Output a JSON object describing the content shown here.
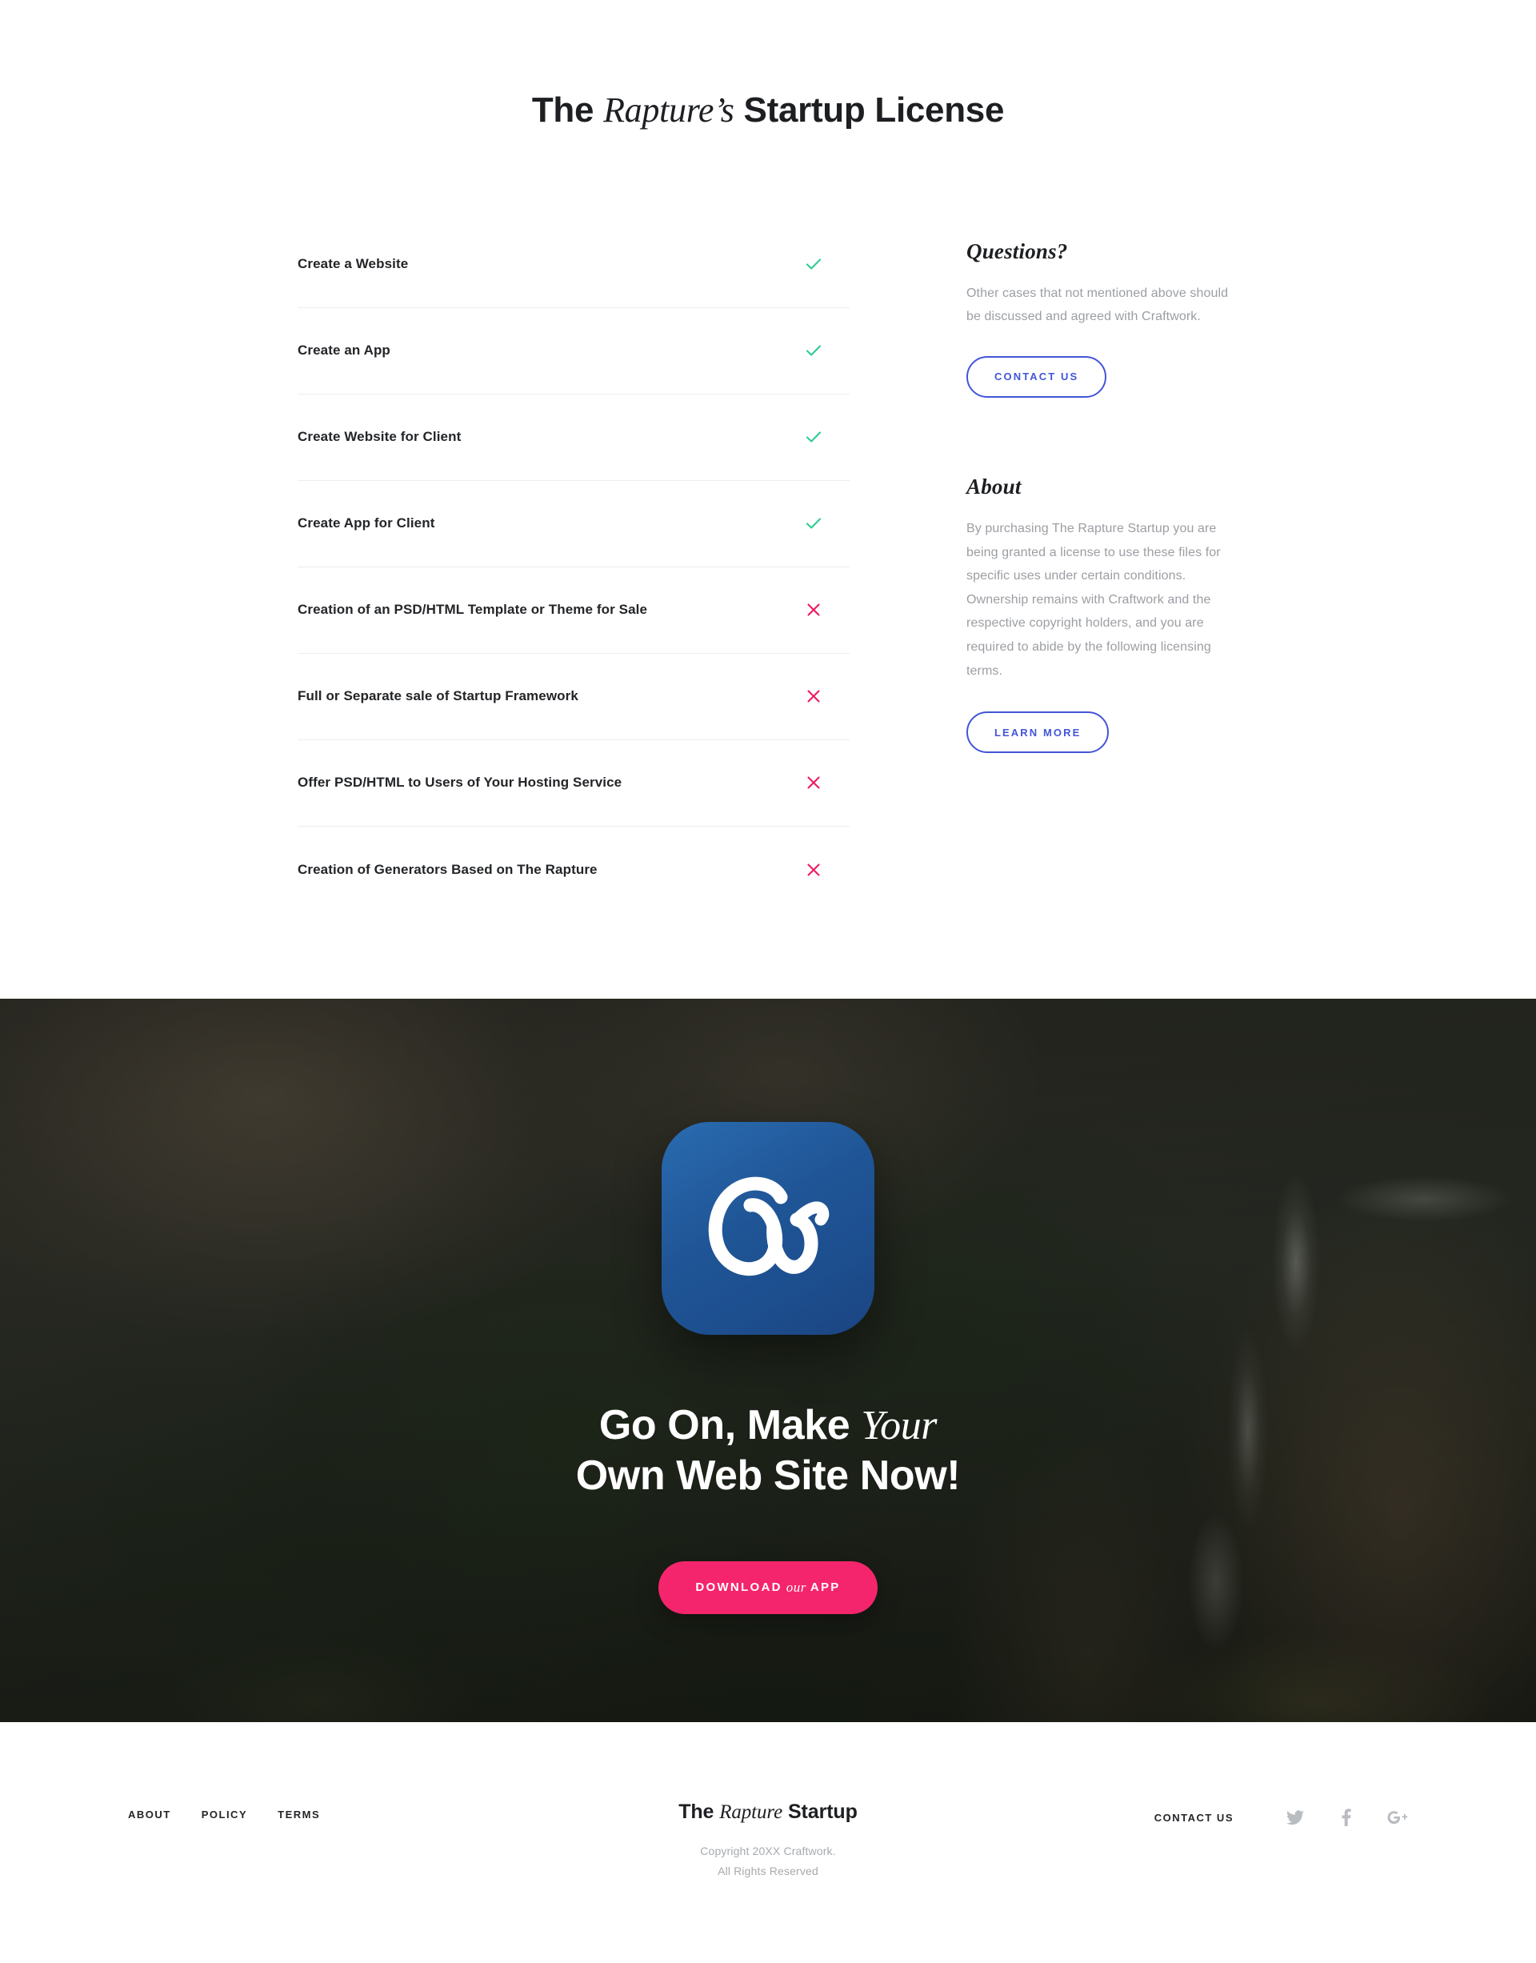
{
  "license": {
    "title_prefix": "The ",
    "title_italic": "Rapture’s",
    "title_suffix": " Startup License",
    "permissions": [
      {
        "label": "Create a Website",
        "mark": "check"
      },
      {
        "label": "Create an App",
        "mark": "check"
      },
      {
        "label": "Create Website for Client",
        "mark": "check"
      },
      {
        "label": "Create App for Client",
        "mark": "check"
      },
      {
        "label": "Creation of an PSD/HTML Template or Theme for Sale",
        "mark": "cross"
      },
      {
        "label": "Full or Separate sale of Startup Framework",
        "mark": "cross"
      },
      {
        "label": "Offer PSD/HTML to Users of Your Hosting Service",
        "mark": "cross"
      },
      {
        "label": "Creation of Generators Based on The Rapture",
        "mark": "cross"
      }
    ],
    "aside": {
      "questions_heading": "Questions?",
      "questions_body": "Other cases that not mentioned above should be discussed and agreed with Craftwork.",
      "contact_button": "Contact Us",
      "about_heading": "About",
      "about_body": "By purchasing The Rapture Startup you are being granted a license to use these files for specific uses under certain conditions. Ownership remains with Craftwork and the respective copyright holders, and you are required to abide by the following licensing terms.",
      "learn_button": "Learn More"
    }
  },
  "hero": {
    "app_icon_name": "craftwork-cw-monogram-icon",
    "title_line1_prefix": "Go On, Make ",
    "title_line1_italic": "Your",
    "title_line2": "Own Web Site Now!",
    "download_prefix": "Download",
    "download_italic": "our",
    "download_suffix": "App"
  },
  "footer": {
    "nav": [
      {
        "label": "About"
      },
      {
        "label": "Policy"
      },
      {
        "label": "Terms"
      }
    ],
    "brand_prefix": "The ",
    "brand_italic": "Rapture",
    "brand_suffix": " Startup",
    "copyright_line1": "Copyright 20XX Craftwork.",
    "copyright_line2": "All Rights Reserved",
    "contact_label": "Contact Us",
    "social": [
      {
        "name": "twitter-icon"
      },
      {
        "name": "facebook-icon"
      },
      {
        "name": "google-plus-icon"
      }
    ]
  },
  "colors": {
    "check_green": "#2ecc8f",
    "cross_pink": "#ed1e64",
    "accent_blue": "#4355d8",
    "cta_pink": "#f4256c",
    "app_icon_blue": "#1f5596",
    "text_dark": "#232528",
    "text_muted": "#9b9ea3",
    "divider": "#ededed"
  }
}
